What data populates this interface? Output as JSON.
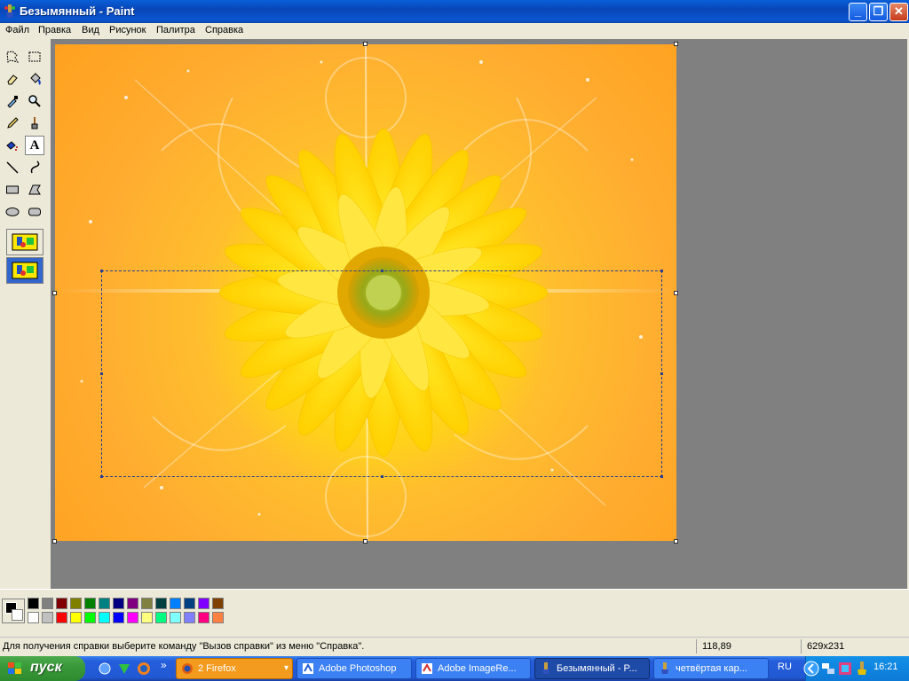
{
  "window": {
    "title": "Безымянный - Paint",
    "controls": {
      "minimize": "_",
      "maximize": "❐",
      "close": "✕"
    }
  },
  "menu": [
    "Файл",
    "Правка",
    "Вид",
    "Рисунок",
    "Палитра",
    "Справка"
  ],
  "tools": [
    {
      "name": "free-form-select-icon"
    },
    {
      "name": "rect-select-icon"
    },
    {
      "name": "eraser-icon"
    },
    {
      "name": "fill-bucket-icon"
    },
    {
      "name": "color-picker-icon"
    },
    {
      "name": "magnifier-icon"
    },
    {
      "name": "pencil-icon"
    },
    {
      "name": "brush-icon"
    },
    {
      "name": "airbrush-icon"
    },
    {
      "name": "text-tool-icon",
      "label": "A"
    },
    {
      "name": "line-icon"
    },
    {
      "name": "curve-icon"
    },
    {
      "name": "rectangle-icon"
    },
    {
      "name": "polygon-icon"
    },
    {
      "name": "ellipse-icon"
    },
    {
      "name": "rounded-rect-icon"
    }
  ],
  "palette": {
    "foreground": "#000000",
    "background": "#ffffff",
    "colors_top": [
      "#000000",
      "#808080",
      "#800000",
      "#808000",
      "#008000",
      "#008080",
      "#000080",
      "#800080",
      "#808040",
      "#004040",
      "#0080ff",
      "#004080",
      "#8000ff",
      "#804000"
    ],
    "colors_bottom": [
      "#ffffff",
      "#c0c0c0",
      "#ff0000",
      "#ffff00",
      "#00ff00",
      "#00ffff",
      "#0000ff",
      "#ff00ff",
      "#ffff80",
      "#00ff80",
      "#80ffff",
      "#8080ff",
      "#ff0080",
      "#ff8040"
    ]
  },
  "status": {
    "help_text": "Для получения справки выберите команду \"Вызов справки\" из меню \"Справка\".",
    "cursor_pos": "118,89",
    "selection_size": "629x231"
  },
  "taskbar": {
    "start_label": "пуск",
    "quick_launch_more": "»",
    "tasks": [
      {
        "label": "2 Firefox",
        "dropdown": "▾"
      },
      {
        "label": "Adobe Photoshop"
      },
      {
        "label": "Adobe ImageRe..."
      },
      {
        "label": "Безымянный - P..."
      },
      {
        "label": "четвёртая кар..."
      }
    ],
    "language": "RU",
    "clock": "16:21"
  }
}
